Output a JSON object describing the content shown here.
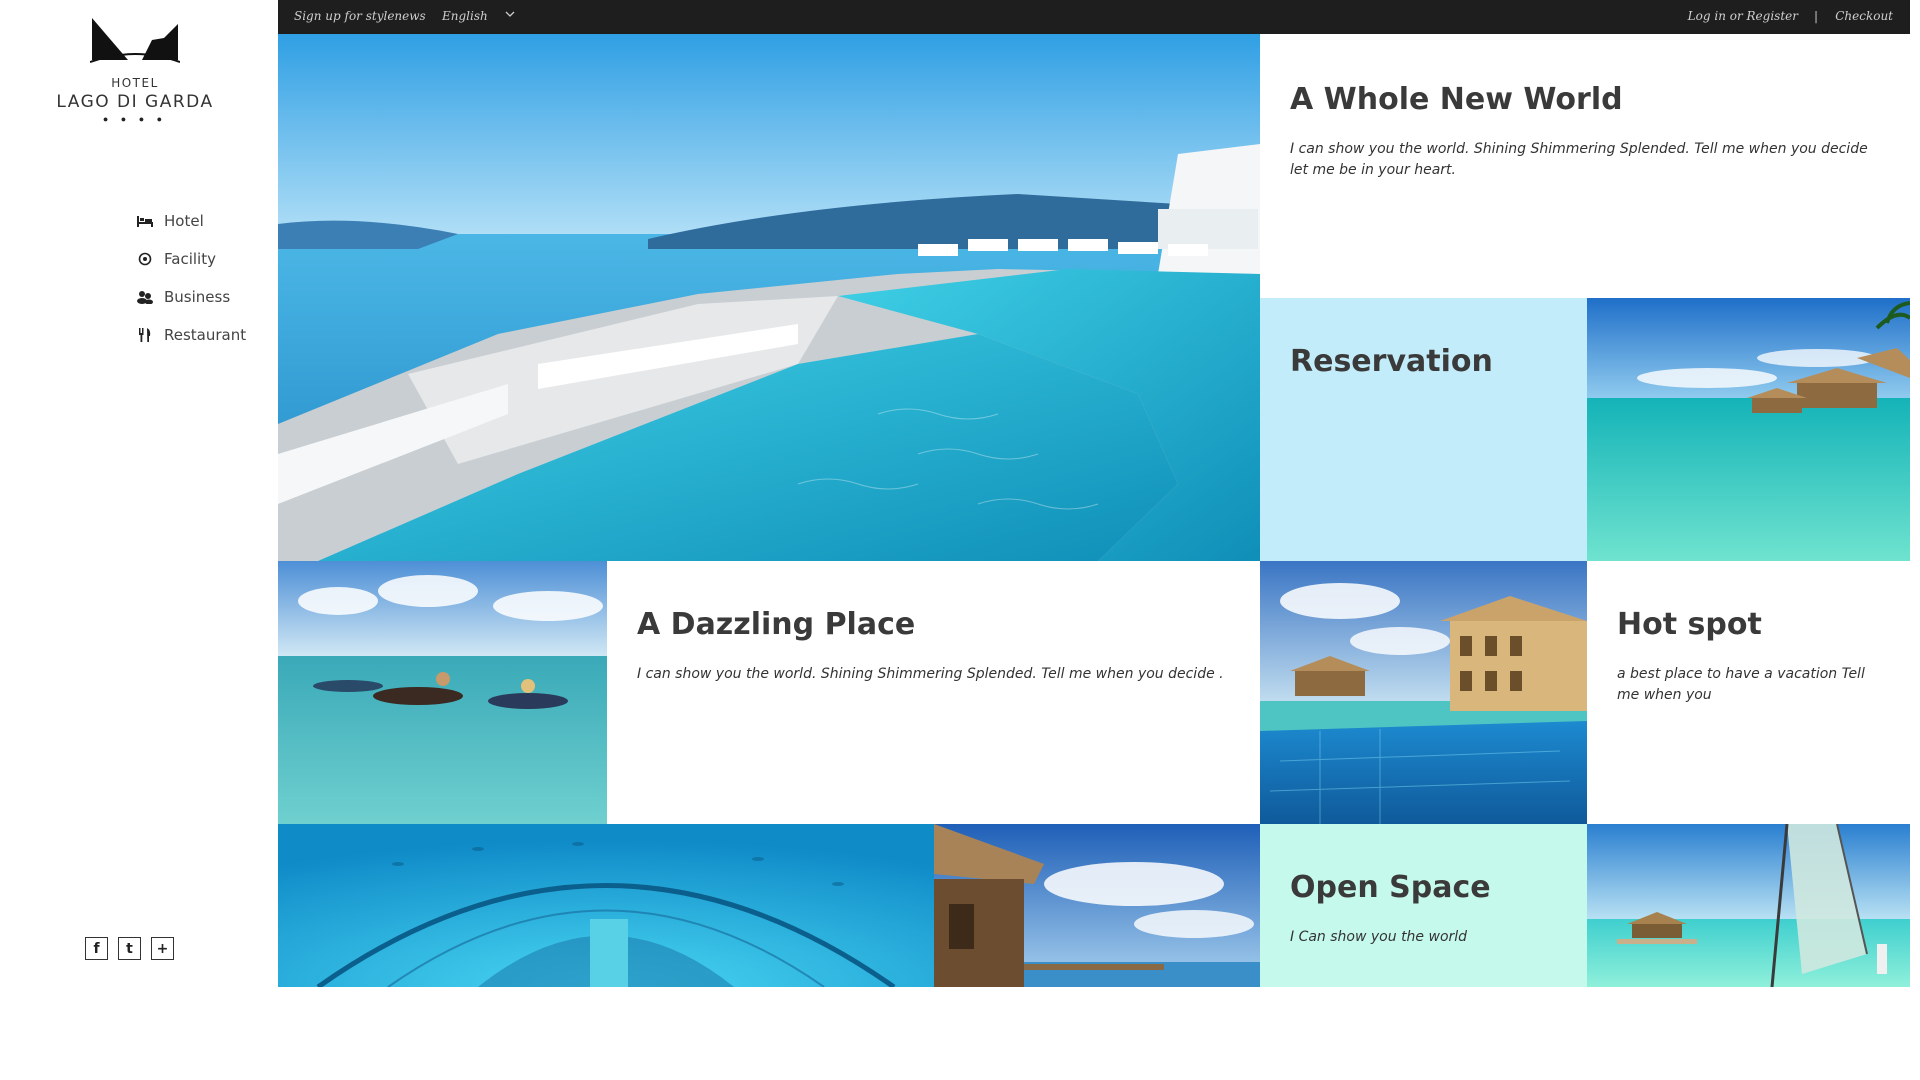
{
  "brand": {
    "hotel_label": "HOTEL",
    "name": "LAGO DI GARDA",
    "stars": "● ● ● ●"
  },
  "nav": {
    "items": [
      {
        "label": "Hotel",
        "icon": "bed-icon"
      },
      {
        "label": "Facility",
        "icon": "target-icon"
      },
      {
        "label": "Business",
        "icon": "people-icon"
      },
      {
        "label": "Restaurant",
        "icon": "cutlery-icon"
      }
    ]
  },
  "social": {
    "facebook": "f",
    "twitter": "t",
    "plus": "+"
  },
  "topbar": {
    "signup": "Sign up for stylenews",
    "language": "English",
    "login": "Log in or Register",
    "separator": "|",
    "checkout": "Checkout"
  },
  "tiles": {
    "whole_new_world": {
      "title": "A Whole New World",
      "text": "I can show you the world. Shining Shimmering Splended. Tell me when you decide let me be in your heart."
    },
    "reservation": {
      "title": "Reservation",
      "bg": "#c2ecfa"
    },
    "dazzling": {
      "title": "A Dazzling Place",
      "text": "I can show you the world. Shining Shimmering Splended. Tell me when you decide ."
    },
    "hot_spot": {
      "title": "Hot spot",
      "text": "a best place to have a vacation Tell me when you"
    },
    "open_space": {
      "title": "Open Space",
      "text": "I Can show you the world",
      "bg": "#c5f9ec"
    }
  },
  "colors": {
    "topbar": "#1e1e1e",
    "sea": "#2ab3d6",
    "sky": "#7cc8ef"
  }
}
